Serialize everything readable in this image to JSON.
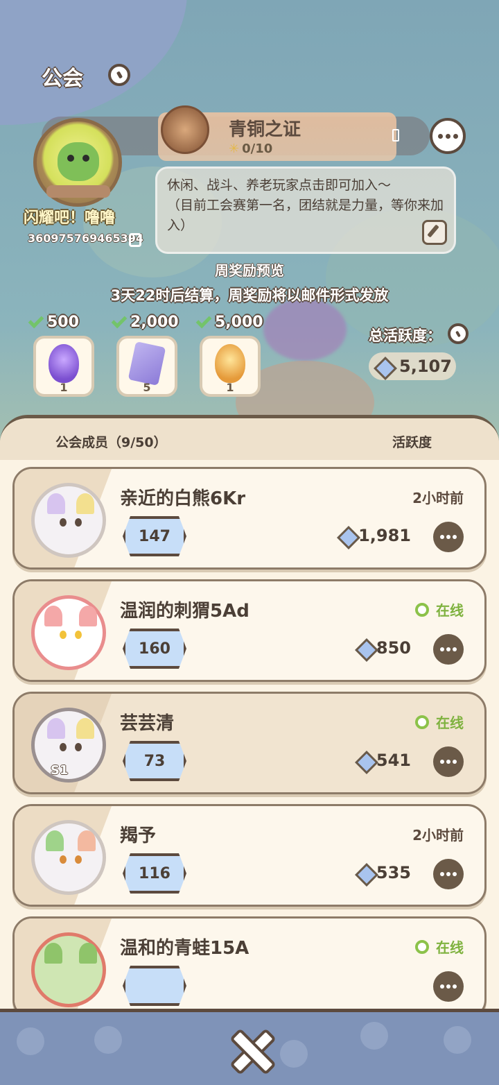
{
  "header": {
    "title": "公会"
  },
  "guild": {
    "name": "闪耀吧！噜噜",
    "id": "360975769465394",
    "description": "休闲、战斗、养老玩家点击即可加入～\n（目前工会赛第一名，团结就是力量，等你来加入）"
  },
  "badge": {
    "title": "青铜之证",
    "progress": "0/10"
  },
  "weekly": {
    "title": "周奖励预览",
    "subtitle": "3天22时后结算，周奖励将以邮件形式发放",
    "tiers": [
      {
        "threshold": "500",
        "qty": "1",
        "icon": "purple-egg-s1"
      },
      {
        "threshold": "2,000",
        "qty": "5",
        "icon": "purple-card"
      },
      {
        "threshold": "5,000",
        "qty": "1",
        "icon": "gold-egg-s1"
      }
    ]
  },
  "total": {
    "label": "总活跃度：",
    "value": "5,107"
  },
  "members_header": {
    "label": "公会成员（9/50）",
    "activity": "活跃度"
  },
  "members": [
    {
      "name": "亲近的白熊6Kr",
      "status": "2小时前",
      "online": false,
      "level": "147",
      "activity": "1,981"
    },
    {
      "name": "温润的刺猬5Ad",
      "status": "在线",
      "online": true,
      "level": "160",
      "activity": "850"
    },
    {
      "name": "芸芸清",
      "status": "在线",
      "online": true,
      "level": "73",
      "activity": "541",
      "tag": "S1"
    },
    {
      "name": "羯予",
      "status": "2小时前",
      "online": false,
      "level": "116",
      "activity": "535"
    },
    {
      "name": "温和的青蛙15A",
      "status": "在线",
      "online": true,
      "level": "",
      "activity": ""
    }
  ],
  "colors": {
    "accent": "#5c4a3e",
    "online": "#8cc24a",
    "level_badge": "#c7def8"
  }
}
